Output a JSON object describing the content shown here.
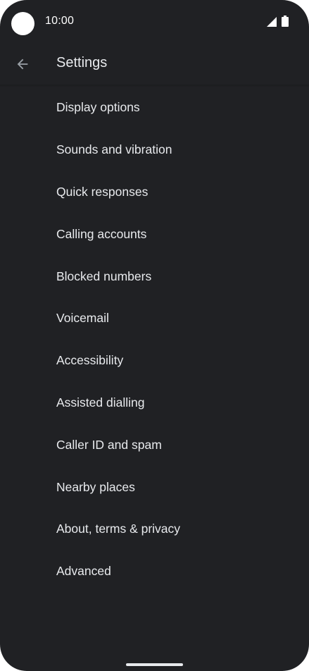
{
  "status_bar": {
    "time": "10:00"
  },
  "toolbar": {
    "back_icon": "arrow-back-icon",
    "title": "Settings"
  },
  "settings": {
    "items": [
      {
        "label": "Display options"
      },
      {
        "label": "Sounds and vibration"
      },
      {
        "label": "Quick responses"
      },
      {
        "label": "Calling accounts"
      },
      {
        "label": "Blocked numbers"
      },
      {
        "label": "Voicemail"
      },
      {
        "label": "Accessibility"
      },
      {
        "label": "Assisted dialling"
      },
      {
        "label": "Caller ID and spam"
      },
      {
        "label": "Nearby places"
      },
      {
        "label": "About, terms & privacy"
      },
      {
        "label": "Advanced"
      }
    ]
  },
  "colors": {
    "background": "#202124",
    "text": "#e8eaed",
    "icon_muted": "#9aa0a6"
  }
}
